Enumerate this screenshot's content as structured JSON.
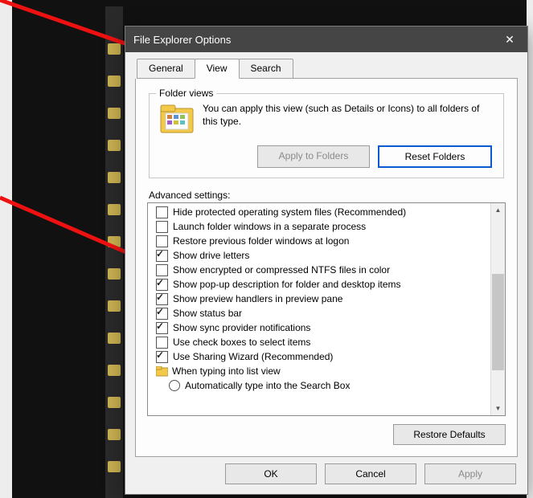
{
  "dialog": {
    "title": "File Explorer Options"
  },
  "tabs": {
    "general": "General",
    "view": "View",
    "search": "Search"
  },
  "folder_views": {
    "legend": "Folder views",
    "description": "You can apply this view (such as Details or Icons) to all folders of this type.",
    "apply_btn": "Apply to Folders",
    "reset_btn": "Reset Folders"
  },
  "adv": {
    "label": "Advanced settings:",
    "items": [
      {
        "type": "checkbox",
        "checked": false,
        "label": "Hide protected operating system files (Recommended)"
      },
      {
        "type": "checkbox",
        "checked": false,
        "label": "Launch folder windows in a separate process"
      },
      {
        "type": "checkbox",
        "checked": false,
        "label": "Restore previous folder windows at logon"
      },
      {
        "type": "checkbox",
        "checked": true,
        "label": "Show drive letters"
      },
      {
        "type": "checkbox",
        "checked": false,
        "label": "Show encrypted or compressed NTFS files in color"
      },
      {
        "type": "checkbox",
        "checked": true,
        "label": "Show pop-up description for folder and desktop items"
      },
      {
        "type": "checkbox",
        "checked": true,
        "label": "Show preview handlers in preview pane"
      },
      {
        "type": "checkbox",
        "checked": true,
        "label": "Show status bar"
      },
      {
        "type": "checkbox",
        "checked": true,
        "label": "Show sync provider notifications"
      },
      {
        "type": "checkbox",
        "checked": false,
        "label": "Use check boxes to select items"
      },
      {
        "type": "checkbox",
        "checked": true,
        "label": "Use Sharing Wizard (Recommended)"
      },
      {
        "type": "tree",
        "label": "When typing into list view"
      },
      {
        "type": "radio",
        "indent": 1,
        "label": "Automatically type into the Search Box"
      }
    ]
  },
  "buttons": {
    "restore_defaults": "Restore Defaults",
    "ok": "OK",
    "cancel": "Cancel",
    "apply": "Apply"
  }
}
